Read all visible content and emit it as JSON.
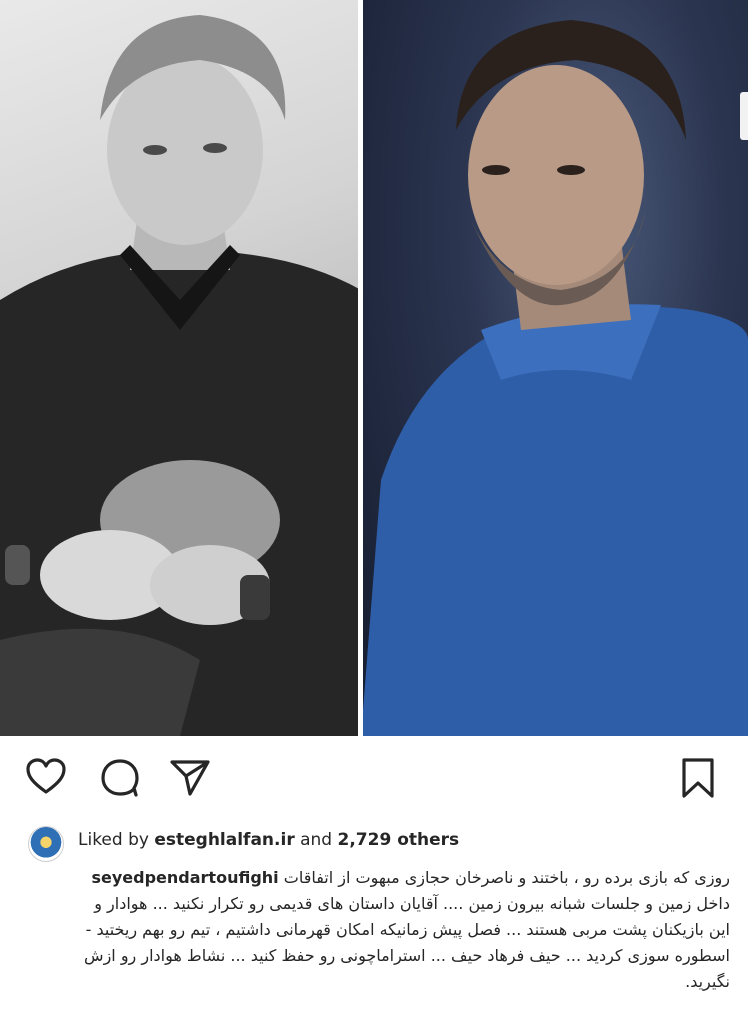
{
  "post": {
    "likes": {
      "prefix": "Liked by",
      "liker": "esteghlalfan.ir",
      "conjunction": "and",
      "count_text": "2,729 others"
    },
    "caption": {
      "username": "seyedpendartoufighi",
      "line1": "روزی که بازی برده رو ، باختند و ناصرخان حجازی مبهوت از اتفاقات",
      "line2": "داخل زمین و جلسات شبانه بیرون زمین .... آقایان داستان های قدیمی رو تکرار نکنید ... هوادار و",
      "line3": "این بازیکنان پشت مربی هستند ... فصل پیش زمانیکه امکان قهرمانی داشتیم ، تیم رو بهم ریختید -",
      "line4": "اسطوره سوزی کردید ... حیف فرهاد حیف ... استراماچونی رو حفظ کنید ... نشاط هوادار رو ازش",
      "line5": "نگیرید."
    },
    "icons": {
      "like": "heart-icon",
      "comment": "comment-bubble-icon",
      "share": "paper-plane-icon",
      "save": "bookmark-icon"
    }
  }
}
